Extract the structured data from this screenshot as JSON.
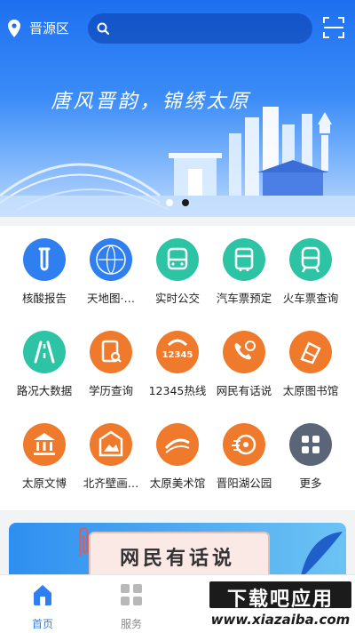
{
  "header": {
    "location": "晋源区",
    "search_placeholder": ""
  },
  "banner": {
    "slogan": "唐风晋韵，锦绣太原",
    "active_slide": 2,
    "slide_count": 2
  },
  "services": [
    {
      "label": "核酸报告",
      "icon": "test-tube-icon",
      "color": "#2f7ff0"
    },
    {
      "label": "天地图·…",
      "icon": "map-world-icon",
      "color": "#2f7ff0"
    },
    {
      "label": "实时公交",
      "icon": "bus-icon",
      "color": "#2dc4a6"
    },
    {
      "label": "汽车票预定",
      "icon": "coach-ticket-icon",
      "color": "#2dc4a6"
    },
    {
      "label": "火车票查询",
      "icon": "train-icon",
      "color": "#2dc4a6"
    },
    {
      "label": "路况大数据",
      "icon": "road-icon",
      "color": "#2dc4a6"
    },
    {
      "label": "学历查询",
      "icon": "education-search-icon",
      "color": "#f07a2c"
    },
    {
      "label": "12345热线",
      "icon": "hotline-12345-icon",
      "color": "#f07a2c"
    },
    {
      "label": "网民有话说",
      "icon": "phone-chat-icon",
      "color": "#f07a2c"
    },
    {
      "label": "太原图书馆",
      "icon": "library-icon",
      "color": "#f07a2c"
    },
    {
      "label": "太原文博",
      "icon": "museum-icon",
      "color": "#f07a2c"
    },
    {
      "label": "北齐壁画…",
      "icon": "mural-icon",
      "color": "#f07a2c"
    },
    {
      "label": "太原美术馆",
      "icon": "art-museum-icon",
      "color": "#f07a2c"
    },
    {
      "label": "晋阳湖公园",
      "icon": "park-icon",
      "color": "#f07a2c"
    },
    {
      "label": "更多",
      "icon": "more-grid-icon",
      "color": "#5a6678"
    }
  ],
  "promo": {
    "title": "网民有话说"
  },
  "tabbar": {
    "items": [
      {
        "label": "首页",
        "icon": "home-icon",
        "active": true
      },
      {
        "label": "服务",
        "icon": "services-grid-icon",
        "active": false
      }
    ]
  },
  "watermark": {
    "text": "下载吧应用",
    "url": "www.xiazaiba.com"
  },
  "colors": {
    "primary": "#1e6ff0",
    "tab_active": "#2f7ff0",
    "tab_inactive": "#8a8a8a"
  }
}
